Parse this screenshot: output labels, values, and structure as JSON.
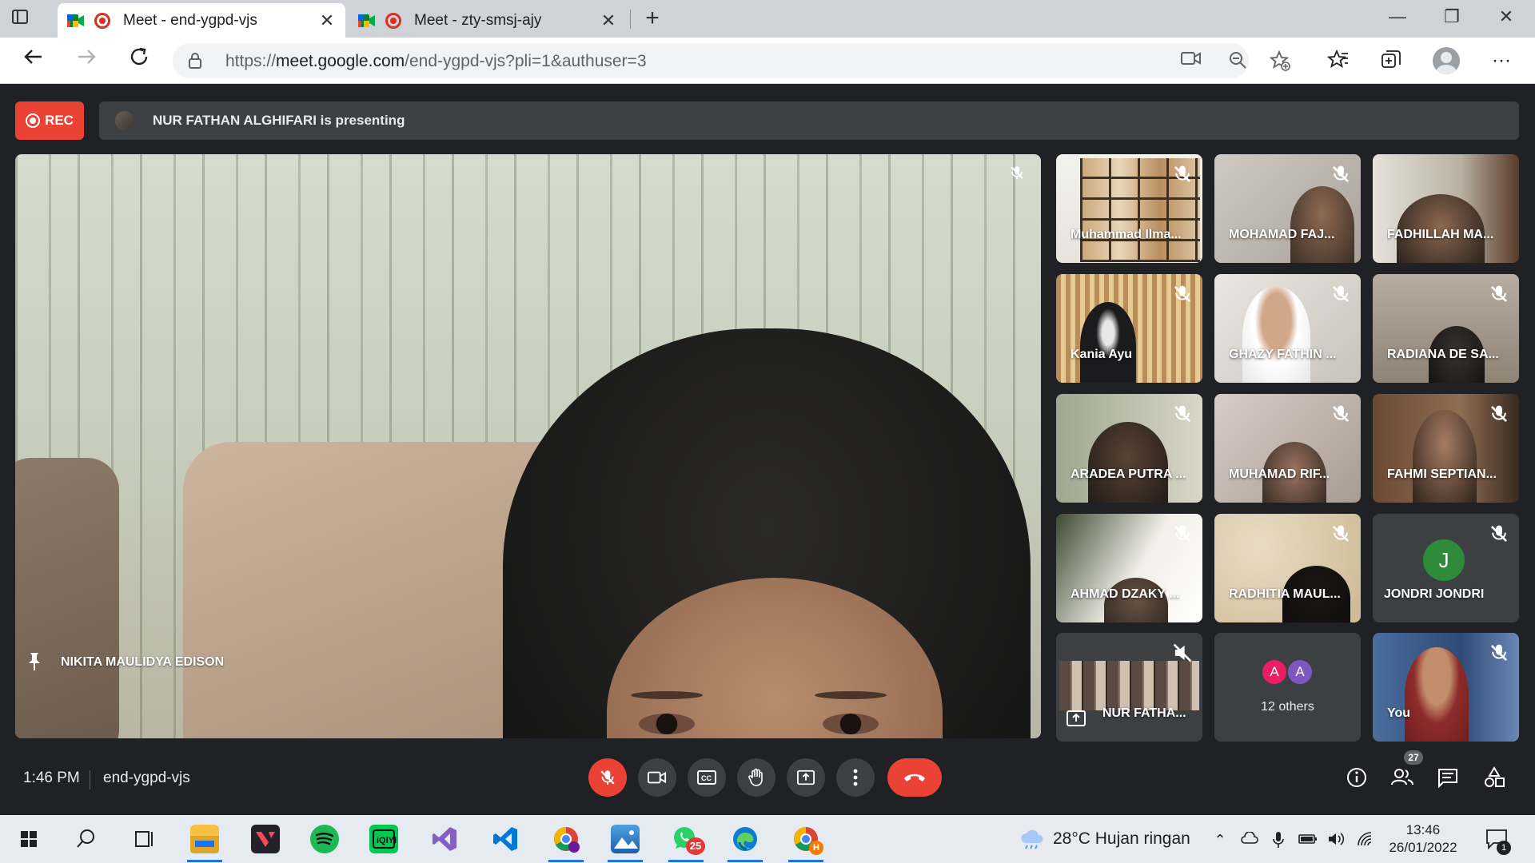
{
  "browser": {
    "tabs": [
      {
        "title": "Meet - end-ygpd-vjs",
        "active": true
      },
      {
        "title": "Meet - zty-smsj-ajy",
        "active": false
      }
    ],
    "url_prefix": "https://",
    "url_host": "meet.google.com",
    "url_path": "/end-ygpd-vjs?pli=1&authuser=3"
  },
  "meet": {
    "rec_label": "REC",
    "presenting_text": "NUR FATHAN ALGHIFARI is presenting",
    "main_speaker": "NIKITA MAULIDYA EDISON",
    "tiles": [
      {
        "name": "Muhammad Ilma..."
      },
      {
        "name": "MOHAMAD FAJ..."
      },
      {
        "name": "FADHILLAH MA..."
      },
      {
        "name": "Kania Ayu"
      },
      {
        "name": "GHAZY FATHIN ..."
      },
      {
        "name": "RADIANA DE SA..."
      },
      {
        "name": "ARADEA PUTRA ..."
      },
      {
        "name": "MUHAMAD RIF..."
      },
      {
        "name": "FAHMI SEPTIAN..."
      },
      {
        "name": "AHMAD DZAKY ..."
      },
      {
        "name": "RADHITIA MAUL..."
      },
      {
        "name": "JONDRI JONDRI",
        "initial": "J"
      },
      {
        "name": "NUR FATHA..."
      },
      {
        "name": "12 others",
        "avatars": [
          "A",
          "A"
        ]
      },
      {
        "name": "You"
      }
    ],
    "time": "1:46 PM",
    "meeting_code": "end-ygpd-vjs",
    "participant_count": "27"
  },
  "taskbar": {
    "weather": "28°C  Hujan ringan",
    "time": "13:46",
    "date": "26/01/2022",
    "notifications": "1",
    "whatsapp_badge": "25",
    "chrome_badge": "H"
  },
  "colors": {
    "meet_bg": "#202124",
    "rec_red": "#ea4335",
    "control_gray": "#3c4043",
    "avatar_green": "#2e8b3a",
    "avatar_pink": "#e91e63",
    "avatar_purple": "#7e57c2"
  }
}
